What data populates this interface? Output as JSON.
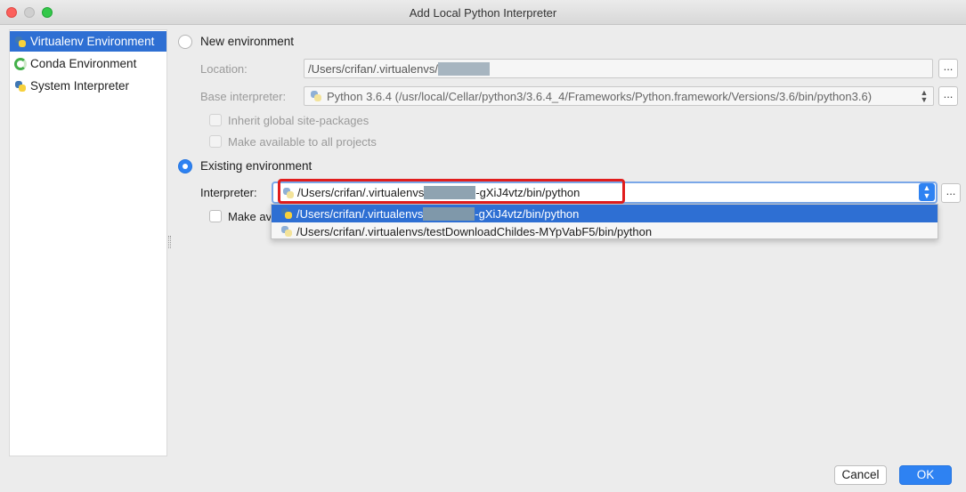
{
  "window": {
    "title": "Add Local Python Interpreter"
  },
  "sidebar": {
    "items": [
      {
        "label": "Virtualenv Environment",
        "icon": "python-icon",
        "selected": true
      },
      {
        "label": "Conda Environment",
        "icon": "conda-icon",
        "selected": false
      },
      {
        "label": "System Interpreter",
        "icon": "python-icon",
        "selected": false
      }
    ]
  },
  "new_environment": {
    "radio_label": "New environment",
    "selected": false,
    "location_label": "Location:",
    "location_value": "/Users/crifan/.virtualenvs/",
    "base_interpreter_label": "Base interpreter:",
    "base_interpreter_value": "Python 3.6.4 (/usr/local/Cellar/python3/3.6.4_4/Frameworks/Python.framework/Versions/3.6/bin/python3.6)",
    "inherit_label": "Inherit global site-packages",
    "make_available_label": "Make available to all projects",
    "browse_label": "..."
  },
  "existing_environment": {
    "radio_label": "Existing environment",
    "selected": true,
    "interpreter_label": "Interpreter:",
    "interpreter_prefix": "/Users/crifan/.virtualenvs",
    "interpreter_suffix": "-gXiJ4vtz/bin/python",
    "make_available_partial": "Make av",
    "browse_label": "..."
  },
  "dropdown": {
    "options": [
      {
        "prefix": "/Users/crifan/.virtualenvs",
        "suffix": "-gXiJ4vtz/bin/python",
        "selected": true
      },
      {
        "label": "/Users/crifan/.virtualenvs/testDownloadChildes-MYpVabF5/bin/python",
        "selected": false
      }
    ]
  },
  "buttons": {
    "cancel": "Cancel",
    "ok": "OK"
  },
  "colors": {
    "accent": "#2e82f2",
    "selection": "#2e6fd3",
    "highlight_border": "#e11d1d"
  }
}
